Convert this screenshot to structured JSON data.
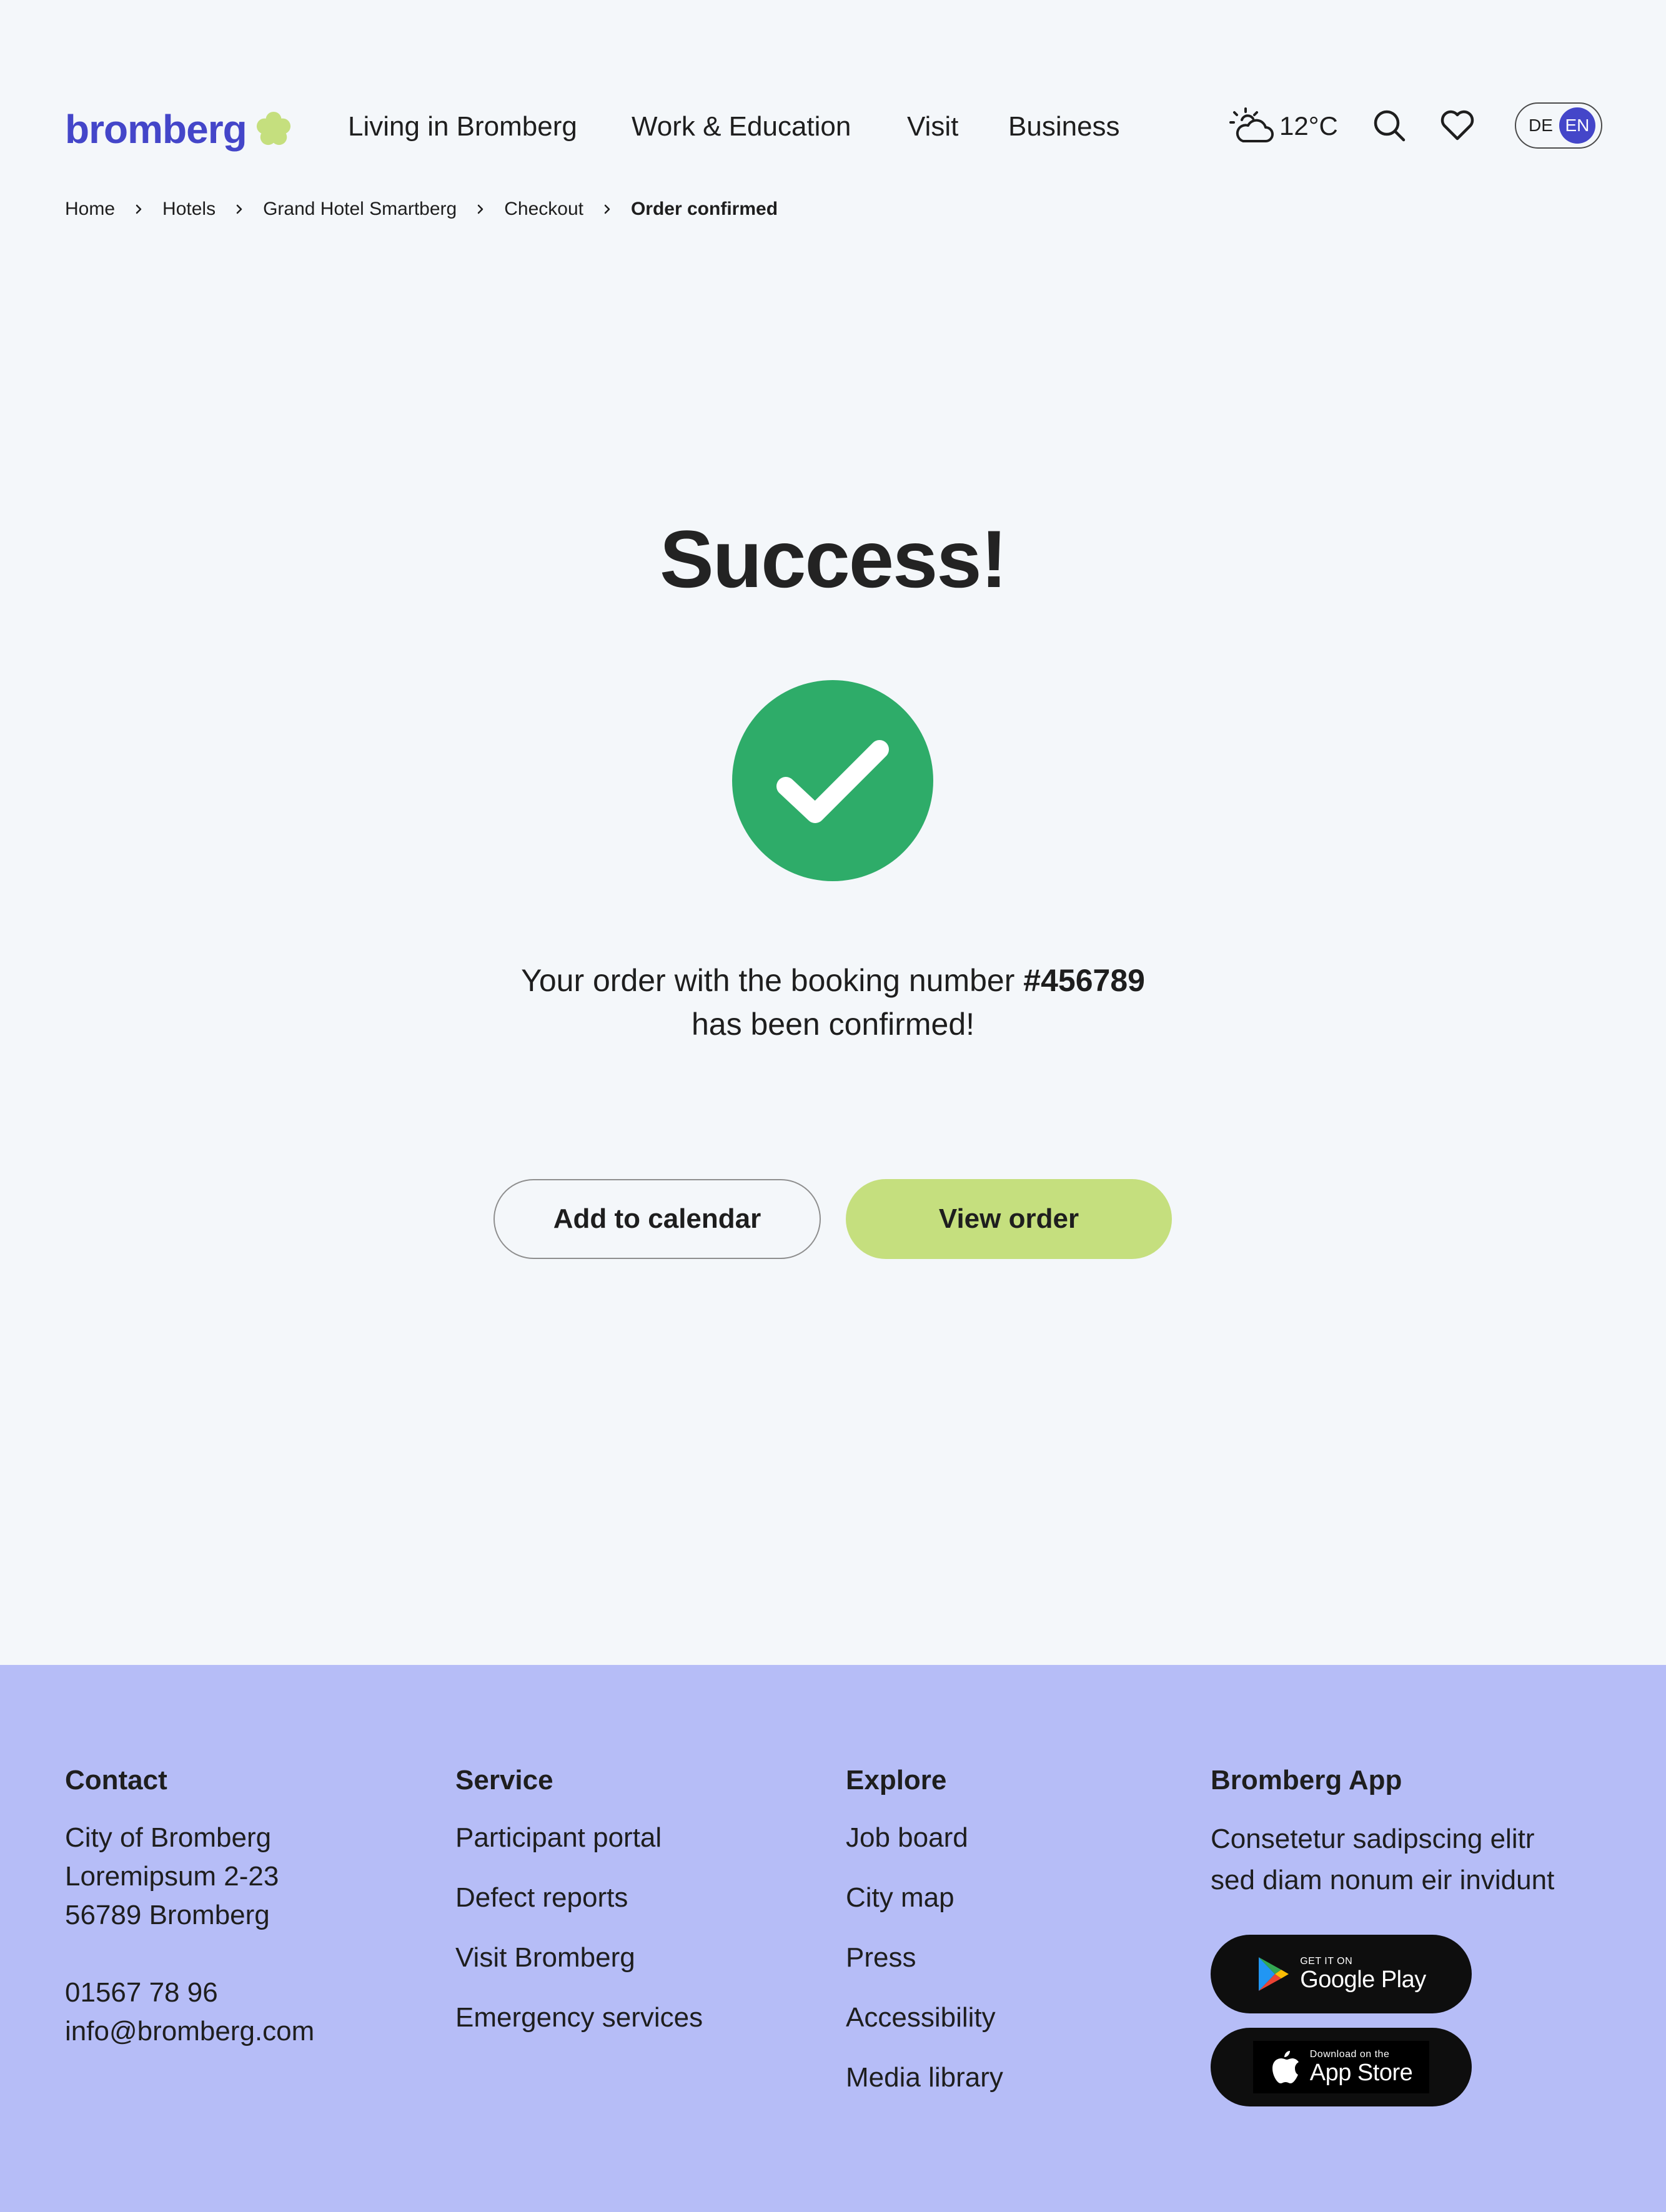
{
  "brand": {
    "name": "bromberg",
    "primary_color": "#4446c9",
    "accent_color": "#c5df7e",
    "success_color": "#2eac69"
  },
  "nav": {
    "items": [
      "Living in Bromberg",
      "Work & Education",
      "Visit",
      "Business"
    ]
  },
  "header": {
    "weather_icon": "partly-cloudy-icon",
    "temperature": "12°C",
    "lang_de": "DE",
    "lang_en": "EN",
    "lang_selected": "EN"
  },
  "breadcrumb": {
    "items": [
      "Home",
      "Hotels",
      "Grand Hotel Smartberg",
      "Checkout"
    ],
    "current": "Order confirmed"
  },
  "main": {
    "title": "Success!",
    "message_pre": "Your order with the booking number",
    "booking_number": "#456789",
    "message_post": "has been confirmed!",
    "btn_calendar": "Add to calendar",
    "btn_view": "View order"
  },
  "footer": {
    "contact": {
      "heading": "Contact",
      "lines": [
        "City of Bromberg",
        "Loremipsum 2-23",
        "56789 Bromberg"
      ],
      "phone": "01567 78 96",
      "email": "info@bromberg.com"
    },
    "service": {
      "heading": "Service",
      "links": [
        "Participant portal",
        "Defect reports",
        "Visit Bromberg",
        "Emergency services"
      ]
    },
    "explore": {
      "heading": "Explore",
      "links": [
        "Job board",
        "City map",
        "Press",
        "Accessibility",
        "Media library"
      ]
    },
    "app": {
      "heading": "Bromberg App",
      "text_line1": "Consetetur sadipscing elitr",
      "text_line2": "sed diam nonum eir invidunt",
      "google_small": "GET IT ON",
      "google_big": "Google Play",
      "apple_small": "Download on the",
      "apple_big": "App Store"
    }
  }
}
